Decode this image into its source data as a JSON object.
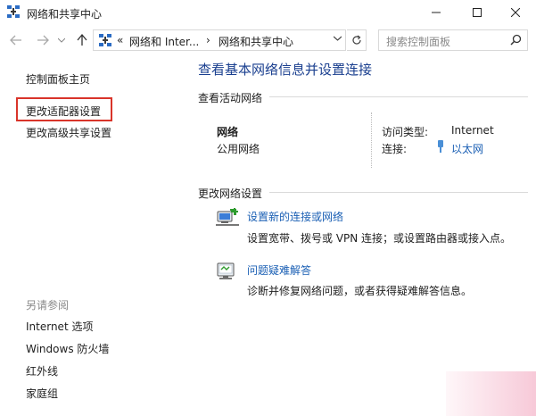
{
  "window": {
    "title": "网络和共享中心"
  },
  "nav": {
    "address_segments": [
      "«",
      "网络和 Inter...",
      "›",
      "网络和共享中心"
    ],
    "search_placeholder": "搜索控制面板"
  },
  "sidebar": {
    "items": [
      "控制面板主页",
      "更改适配器设置",
      "更改高级共享设置"
    ],
    "see_also_label": "另请参阅",
    "see_also_items": [
      "Internet 选项",
      "Windows 防火墙",
      "红外线",
      "家庭组"
    ]
  },
  "main": {
    "title": "查看基本网络信息并设置连接",
    "active_networks_label": "查看活动网络",
    "network_name": "网络",
    "network_type": "公用网络",
    "access_type_label": "访问类型:",
    "access_type_value": "Internet",
    "connections_label": "连接:",
    "connection_value": "以太网",
    "change_settings_label": "更改网络设置",
    "tasks": [
      {
        "link": "设置新的连接或网络",
        "desc": "设置宽带、拨号或 VPN 连接；或设置路由器或接入点。",
        "icon": "network-setup-icon"
      },
      {
        "link": "问题疑难解答",
        "desc": "诊断并修复网络问题，或者获得疑难解答信息。",
        "icon": "troubleshoot-icon"
      }
    ]
  },
  "colors": {
    "title_blue": "#1a3f8f",
    "link_blue": "#1a5fb4",
    "highlight_red": "#d9342a"
  }
}
